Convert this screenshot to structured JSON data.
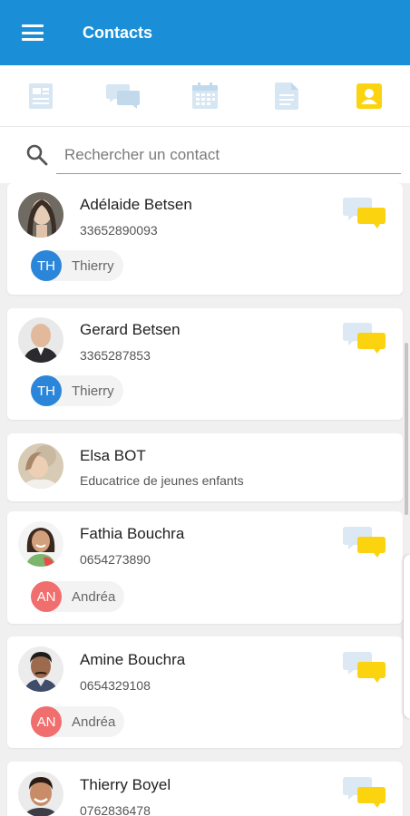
{
  "app": {
    "title": "Contacts",
    "accent": "#1a8fd8"
  },
  "tabs": [
    {
      "icon": "document-icon",
      "active": false
    },
    {
      "icon": "messages-icon",
      "active": false
    },
    {
      "icon": "calendar-icon",
      "active": false
    },
    {
      "icon": "notes-icon",
      "active": false
    },
    {
      "icon": "contacts-icon",
      "active": true
    }
  ],
  "search": {
    "placeholder": "Rechercher un contact",
    "value": ""
  },
  "contacts": [
    {
      "name": "Adélaide Betsen",
      "sub": "33652890093",
      "has_message": true,
      "chip": {
        "initials": "TH",
        "name": "Thierry",
        "color": "#2b86d9"
      }
    },
    {
      "name": "Gerard Betsen",
      "sub": "3365287853",
      "has_message": true,
      "chip": {
        "initials": "TH",
        "name": "Thierry",
        "color": "#2b86d9"
      }
    },
    {
      "name": "Elsa BOT",
      "sub": "Educatrice de jeunes enfants",
      "has_message": false
    },
    {
      "name": "Fathia Bouchra",
      "sub": "0654273890",
      "has_message": true,
      "chip": {
        "initials": "AN",
        "name": "Andréa",
        "color": "#f06e6e"
      }
    },
    {
      "name": "Amine Bouchra",
      "sub": "0654329108",
      "has_message": true,
      "chip": {
        "initials": "AN",
        "name": "Andréa",
        "color": "#f06e6e"
      }
    },
    {
      "name": "Thierry Boyel",
      "sub": "0762836478",
      "has_message": true
    }
  ]
}
